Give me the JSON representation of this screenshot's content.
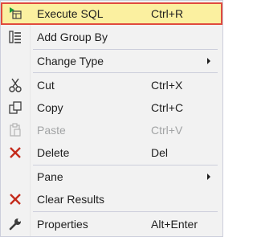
{
  "menu": {
    "items": [
      {
        "label": "Execute SQL",
        "shortcut": "Ctrl+R",
        "icon": "play-icon"
      },
      {
        "label": "Add Group By",
        "shortcut": "",
        "icon": "group-by-icon"
      },
      {
        "label": "Change Type",
        "shortcut": "",
        "icon": "",
        "submenu": true
      },
      {
        "label": "Cut",
        "shortcut": "Ctrl+X",
        "icon": "scissors-icon"
      },
      {
        "label": "Copy",
        "shortcut": "Ctrl+C",
        "icon": "copy-icon"
      },
      {
        "label": "Paste",
        "shortcut": "Ctrl+V",
        "icon": "paste-icon",
        "disabled": true
      },
      {
        "label": "Delete",
        "shortcut": "Del",
        "icon": "delete-x-icon"
      },
      {
        "label": "Pane",
        "shortcut": "",
        "icon": "",
        "submenu": true
      },
      {
        "label": "Clear Results",
        "shortcut": "",
        "icon": "clear-x-icon"
      },
      {
        "label": "Properties",
        "shortcut": "Alt+Enter",
        "icon": "wrench-icon"
      }
    ]
  },
  "colors": {
    "menu_background": "#f2f2f2",
    "highlight_background": "#fbf0a0",
    "highlight_border": "#e04a3e",
    "text": "#1e1e1e",
    "disabled_text": "#a2a4a5",
    "delete_red": "#c42b1c",
    "play_green": "#1e9c3a"
  }
}
